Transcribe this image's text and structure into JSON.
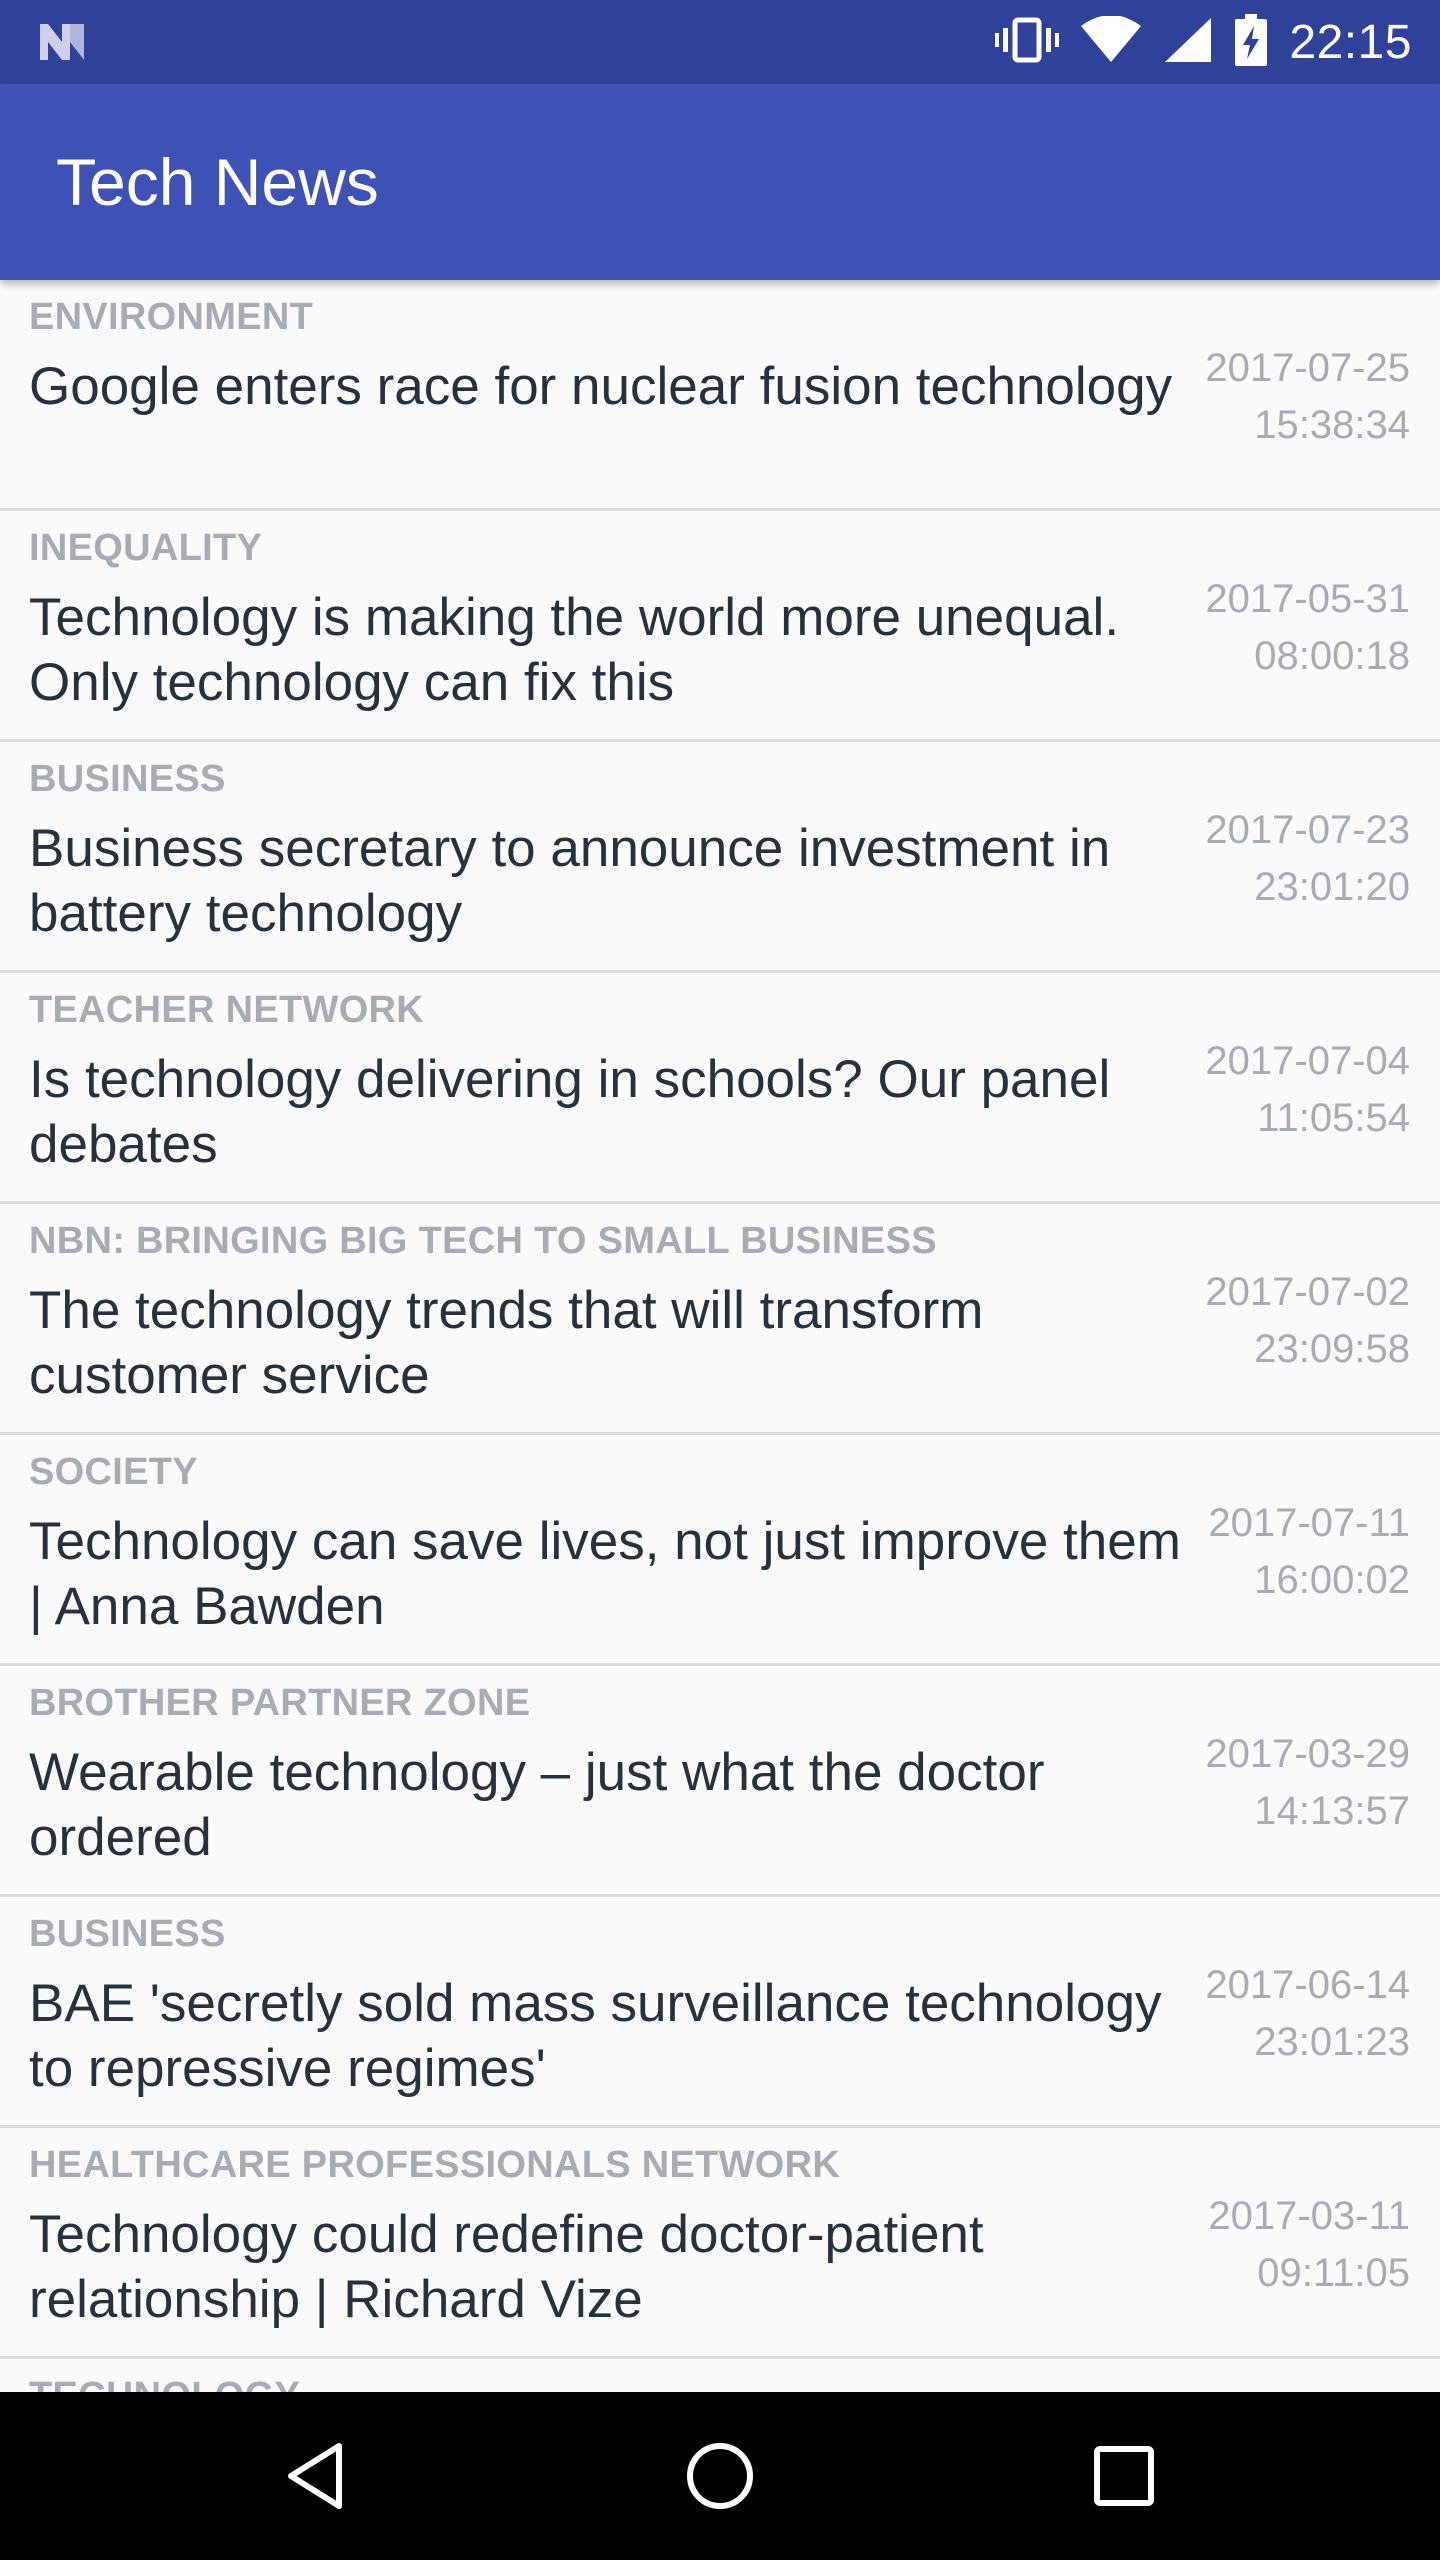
{
  "status_bar": {
    "time": "22:15",
    "icons": [
      "notification-n-icon",
      "vibrate-icon",
      "wifi-icon",
      "signal-icon",
      "battery-charging-icon"
    ]
  },
  "app_bar": {
    "title": "Tech News",
    "color": "#3f51b5",
    "status_color": "#30419a"
  },
  "news": [
    {
      "section": "ENVIRONMENT",
      "title": "Google enters race for nuclear fusion technology",
      "date": "2017-07-25",
      "time": "15:38:34"
    },
    {
      "section": "INEQUALITY",
      "title": "Technology is making the world more unequal. Only technology can fix this",
      "date": "2017-05-31",
      "time": "08:00:18"
    },
    {
      "section": "BUSINESS",
      "title": "Business secretary to announce investment in battery technology",
      "date": "2017-07-23",
      "time": "23:01:20"
    },
    {
      "section": "TEACHER NETWORK",
      "title": "Is technology delivering in schools? Our panel debates",
      "date": "2017-07-04",
      "time": "11:05:54"
    },
    {
      "section": "NBN: BRINGING BIG TECH TO SMALL BUSINESS",
      "title": "The technology trends that will transform customer service",
      "date": "2017-07-02",
      "time": "23:09:58"
    },
    {
      "section": "SOCIETY",
      "title": "Technology can save lives, not just improve them | Anna Bawden",
      "date": "2017-07-11",
      "time": "16:00:02"
    },
    {
      "section": "BROTHER PARTNER ZONE",
      "title": "Wearable technology – just what the doctor ordered",
      "date": "2017-03-29",
      "time": "14:13:57"
    },
    {
      "section": "BUSINESS",
      "title": "BAE 'secretly sold mass surveillance technology to repressive regimes'",
      "date": "2017-06-14",
      "time": "23:01:23"
    },
    {
      "section": "HEALTHCARE PROFESSIONALS NETWORK",
      "title": "Technology could redefine doctor-patient relationship | Richard Vize",
      "date": "2017-03-11",
      "time": "09:11:05"
    },
    {
      "section": "TECHNOLOGY",
      "title": "",
      "date": "",
      "time": ""
    }
  ],
  "nav_bar": {
    "buttons": [
      "back-icon",
      "home-icon",
      "recents-icon"
    ]
  }
}
